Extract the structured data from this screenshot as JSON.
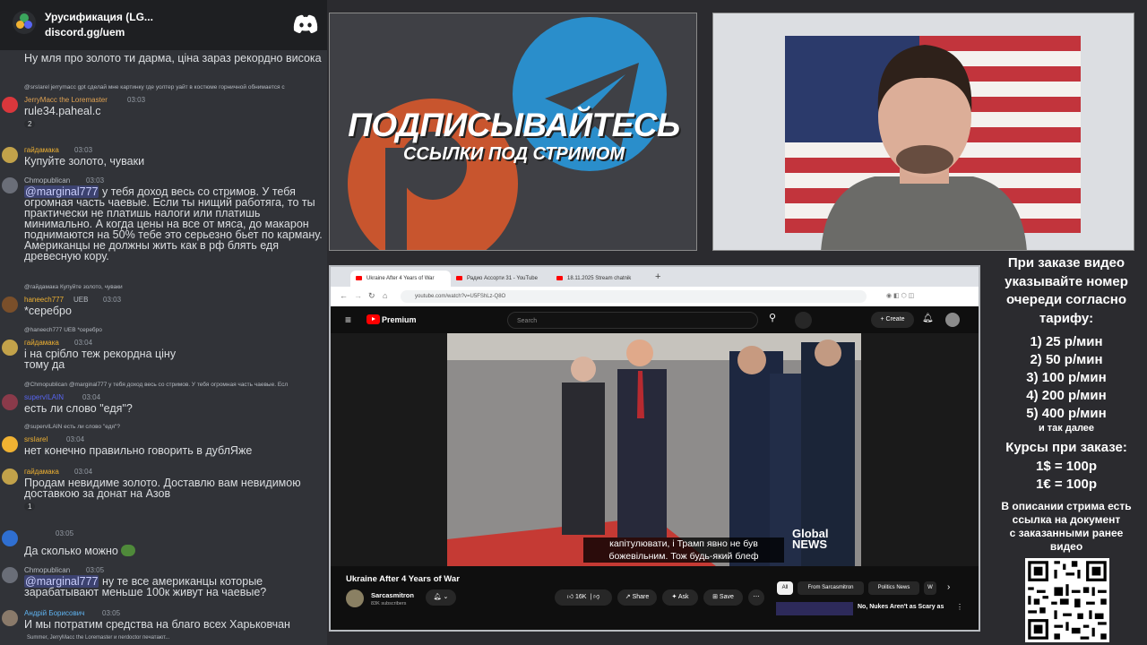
{
  "chat": {
    "server_name": "Урусификация (LG...",
    "server_url": "discord.gg/uem",
    "messages": [
      {
        "name": "",
        "body": "Ну мля про золото ти дарма, ціна зараз рекордно висока"
      },
      {
        "reply": "@srsIarel jerrymacc gpt сделай мне картинку где уолтер уайт в костюме горничной обнимается с",
        "name": "JerryMacc the Loremaster",
        "time": "03:03",
        "body": "rule34.paheal.c",
        "reactions": [
          "2"
        ]
      },
      {
        "name": "гайдамака",
        "time": "03:03",
        "body": "Купуйте золото, чуваки"
      },
      {
        "name": "Chmopublican",
        "time": "03:03",
        "mention": "@marginal777",
        "body": "у тебя доход весь со стримов. У тебя огромная часть чаевые. Если ты нищий работяга, то ты практически не платишь налоги или платишь минимально. А когда цены на все от мяса, до макарон поднимаются на 50% тебе это серьезно бьет по карману. Американцы не должны жить как в рф блять едя древесную кору."
      },
      {
        "reply": "@гайдамака Купуйте золото, чуваки",
        "name": "haneech777",
        "badge": "UEB",
        "time": "03:03",
        "body": "*серебро"
      },
      {
        "reply": "@haneech777 UEB *серебро",
        "name": "гайдамака",
        "time": "03:04",
        "body": "і на срібло теж рекордна ціну тому да"
      },
      {
        "reply": "@Chmopublican @marginal777 у тебя доход весь со стримов. У тебя огромная часть чаевые. Есл",
        "name": "supervILAIN",
        "time": "03:04",
        "body": "есть ли слово \"едя\"?"
      },
      {
        "reply": "@supervILAIN есть ли слово \"едя\"?",
        "name": "srsIarel",
        "time": "03:04",
        "body": "нет конечно правильно говорить в дублЯже"
      },
      {
        "name": "гайдамака",
        "time": "03:04",
        "body": "Продам невидиме золото. Доставлю вам невидимою доставкою за донат на Азов",
        "reactions": [
          "1"
        ]
      },
      {
        "name": "",
        "time": "03:05",
        "body": "Да сколько можно"
      },
      {
        "name": "Chmopublican",
        "time": "03:05",
        "mention": "@marginal777",
        "body": "ну те все американцы которые зарабатывают меньше 100к живут на чаевые?"
      },
      {
        "name": "Андрій Борисович",
        "time": "03:05",
        "body": "И мы потратим средства на благо всех Харьковчан"
      }
    ],
    "typing": "Summer, JerryMacc the Loremaster и nerdoctor печатают..."
  },
  "banner": {
    "line1": "ПОДПИСЫВАЙТЕСЬ",
    "line2": "ССЫЛКИ ПОД СТРИМОМ"
  },
  "browser": {
    "tabs": [
      "Ukraine After 4 Years of War",
      "Радио Ассорти 31 - YouTube",
      "18.11.2025 Stream chatnik"
    ],
    "url": "youtube.com/watch?v=U5FShLz-Q8O",
    "brand": "Premium",
    "search_placeholder": "Search",
    "create_label": "Create",
    "subtitle_line1": "капітулювати, і Трамп явно не був",
    "subtitle_line2": "божевільним.  Тож будь-який блеф",
    "watermark_line1": "Global",
    "watermark_line2": "NEWS",
    "video_title": "Ukraine After 4 Years of War",
    "channel_name": "Sarcasmitron",
    "channel_subs": "83K subscribers",
    "likes": "16K",
    "share": "Share",
    "ask": "Ask",
    "save": "Save",
    "chips": [
      "All",
      "From Sarcasmitron",
      "Politics News",
      "W"
    ],
    "rec_title": "No, Nukes Aren't as Scary as"
  },
  "info": {
    "heading": [
      "При заказе видео",
      "указывайте номер",
      "очереди согласно",
      "тарифу:"
    ],
    "tariffs": [
      "1) 25 р/мин",
      "2) 50 р/мин",
      "3) 100 р/мин",
      "4) 200 р/мин",
      "5) 400 р/мин"
    ],
    "tariffs_more": "и так далее",
    "rates_heading": "Курсы при заказе:",
    "rates": [
      "1$ = 100р",
      "1€ = 100р"
    ],
    "note": [
      "В описании стрима есть",
      "ссылка на документ",
      "с заказанными ранее",
      "видео"
    ]
  },
  "colors": {
    "chat_bg": "#313338",
    "mention_bg": "#3c4270",
    "yt_red": "#ff0000",
    "discord_blurple": "#5865f2"
  }
}
